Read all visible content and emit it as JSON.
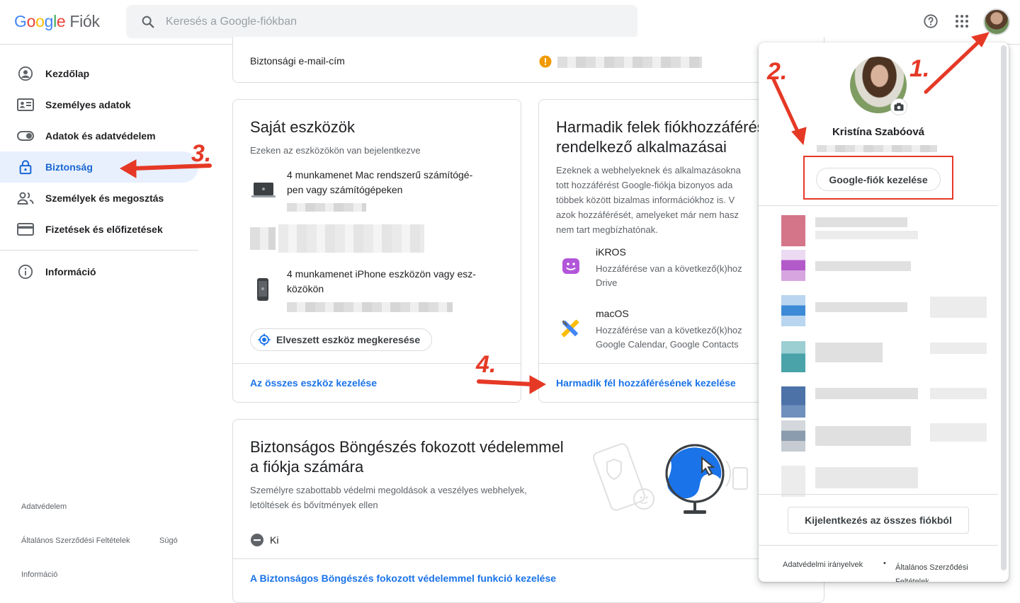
{
  "header": {
    "logo_letters": [
      "G",
      "o",
      "o",
      "g",
      "l",
      "e"
    ],
    "product": "Fiók",
    "search_placeholder": "Keresés a Google-fiókban",
    "icons": [
      "search-icon",
      "help-icon",
      "apps-grid-icon",
      "avatar"
    ]
  },
  "sidebar": {
    "items": [
      {
        "label": "Kezdőlap",
        "icon": "home-user-icon"
      },
      {
        "label": "Személyes adatok",
        "icon": "id-card-icon"
      },
      {
        "label": "Adatok és adatvédelem",
        "icon": "toggle-icon"
      },
      {
        "label": "Biztonság",
        "icon": "lock-icon",
        "active": true
      },
      {
        "label": "Személyek és megosztás",
        "icon": "people-icon"
      },
      {
        "label": "Fizetések és előfizetések",
        "icon": "credit-card-icon"
      },
      {
        "label": "Információ",
        "icon": "info-icon"
      }
    ],
    "footer": {
      "privacy": "Adatvédelem",
      "terms": "Általános Szerződési Feltételek",
      "help": "Súgó",
      "info": "Információ"
    }
  },
  "main": {
    "recovery_email_label": "Biztonsági e-mail-cím",
    "devices": {
      "title": "Saját eszközök",
      "subtitle": "Ezeken az eszközökön van bejelentkezve",
      "mac_line1": "4 munkamenet Mac rendszerű számítógé-",
      "mac_line2": "pen vagy számítógépeken",
      "iphone_line1": "4 munkamenet iPhone eszközön vagy esz-",
      "iphone_line2": "közökön",
      "find_device": "Elveszett eszköz megkeresése",
      "manage_link": "Az összes eszköz kezelése"
    },
    "third_party": {
      "title_line1": "Harmadik felek fiókhozzáférés",
      "title_line2": "rendelkező alkalmazásai",
      "desc_lines": [
        "Ezeknek a webhelyeknek és alkalmazásokna",
        "tott hozzáférést Google-fiókja bizonyos ada",
        "többek között bizalmas információkhoz is. V",
        "azok hozzáférését, amelyeket már nem hasz",
        "nem tart megbízhatónak."
      ],
      "app1_name": "iKROS",
      "app1_line1": "Hozzáférése van a következő(k)hoz",
      "app1_line2": "Drive",
      "app2_name": "macOS",
      "app2_line1": "Hozzáférése van a következő(k)hoz",
      "app2_line2": "Google Calendar, Google Contacts",
      "manage_link": "Harmadik fél hozzáférésének kezelése"
    },
    "safe_browsing": {
      "title_line1": "Biztonságos Böngészés fokozott védelemmel",
      "title_line2": "a fiókja számára",
      "desc_line1": "Személyre szabottabb védelmi megoldások a veszélyes webhelyek,",
      "desc_line2": "letöltések és bővítmények ellen",
      "status": "Ki",
      "manage_link": "A Biztonságos Böngészés fokozott védelemmel funkció kezelése"
    }
  },
  "account_panel": {
    "name": "Kristína Szabóová",
    "manage_button": "Google-fiók kezelése",
    "signout_button": "Kijelentkezés az összes fiókból",
    "privacy_link": "Adatvédelmi irányelvek",
    "separator": "•",
    "terms_link": "Általános Szerződési Feltételek",
    "accounts": [
      {
        "colors": [
          "#d4758a",
          "#d4758a"
        ]
      },
      {
        "colors": [
          "#b25ac9",
          "#d7a6e0"
        ]
      },
      {
        "colors": [
          "#3d8ad6",
          "#b9d5ef"
        ]
      },
      {
        "colors": [
          "#4aa3a8",
          "#9bcfd2"
        ]
      },
      {
        "colors": [
          "#4c72a8",
          "#6f90bd"
        ]
      },
      {
        "colors": [
          "#8a9cad",
          "#c6ccd2"
        ]
      },
      {
        "colors": [
          "#e4e4e4",
          "#ededed"
        ]
      }
    ]
  },
  "annotations": {
    "n1": "1.",
    "n2": "2.",
    "n3": "3.",
    "n4": "4."
  },
  "colors": {
    "accent": "#1a73e8",
    "active_bg": "#e8f0fe",
    "warning": "#f29900",
    "annotation": "#e53926"
  }
}
